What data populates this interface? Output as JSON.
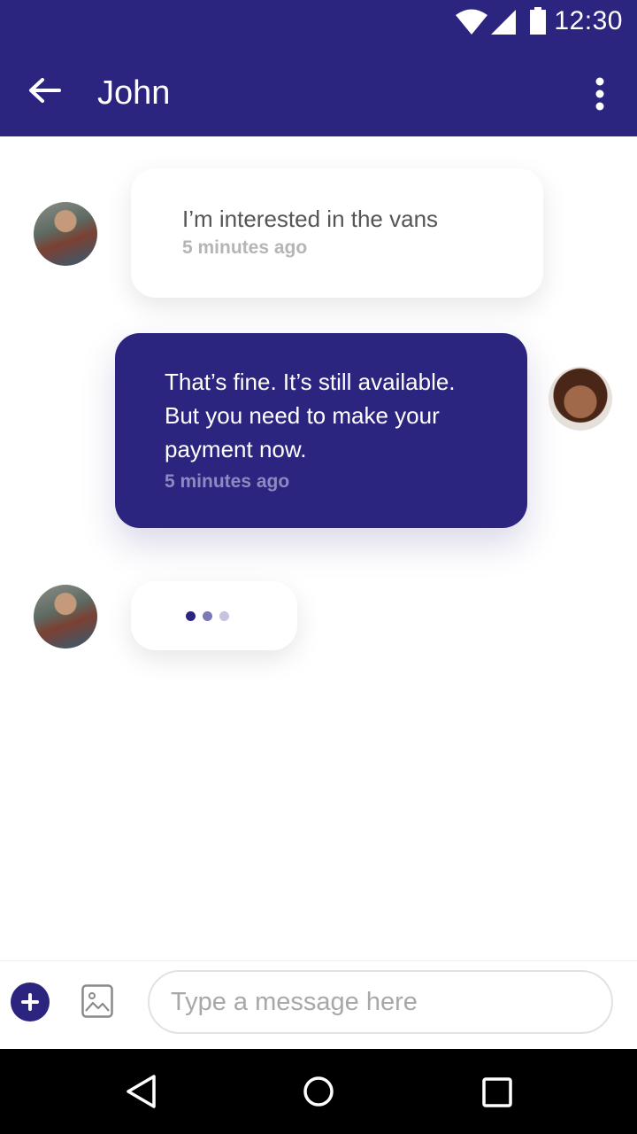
{
  "status_bar": {
    "time": "12:30"
  },
  "app_bar": {
    "title": "John"
  },
  "messages": [
    {
      "sender": "John",
      "text": "I’m interested in the vans",
      "time": "5 minutes ago"
    },
    {
      "sender": "me",
      "lines": [
        "That’s fine. It’s still available.",
        "But you need to make your",
        "payment now."
      ],
      "time": "5 minutes ago"
    }
  ],
  "typing_indicator": {
    "dot_colors": [
      "#2b2580",
      "#7d79b5",
      "#c5c3e0"
    ]
  },
  "composer": {
    "placeholder": "Type a message here"
  },
  "colors": {
    "primary": "#2b2580",
    "background": "#ffffff",
    "nav_bar": "#000000"
  },
  "icons": {
    "status": [
      "wifi-icon",
      "signal-icon",
      "battery-icon"
    ],
    "app_bar": [
      "back-arrow-icon",
      "more-vert-icon"
    ],
    "composer": [
      "add-icon",
      "image-icon"
    ],
    "navigation": [
      "nav-back-icon",
      "nav-home-icon",
      "nav-recents-icon"
    ]
  }
}
